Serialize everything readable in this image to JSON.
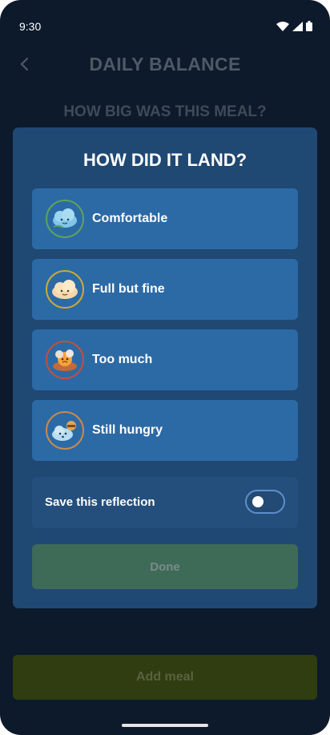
{
  "status_bar": {
    "time": "9:30"
  },
  "header": {
    "title": "DAILY BALANCE",
    "back_icon": "chevron-left-icon"
  },
  "question": "HOW BIG WAS THIS MEAL?",
  "modal": {
    "title": "HOW DID IT LAND?",
    "options": [
      {
        "label": "Comfortable",
        "icon": "calm-cloud-icon",
        "ring_color": "#5ea35a"
      },
      {
        "label": "Full but fine",
        "icon": "full-cloud-icon",
        "ring_color": "#c9a93a"
      },
      {
        "label": "Too much",
        "icon": "overfull-cloud-icon",
        "ring_color": "#c0503e"
      },
      {
        "label": "Still hungry",
        "icon": "hungry-cloud-icon",
        "ring_color": "#c98a4a"
      }
    ],
    "toggle": {
      "label": "Save this reflection",
      "on": false
    },
    "done_label": "Done"
  },
  "add_meal_label": "Add meal",
  "colors": {
    "background": "#0d1a2b",
    "modal": "#1f4873",
    "option": "#2c6aa6",
    "done_disabled": "#3e6a58",
    "add_meal_disabled": "#2f3d10"
  }
}
